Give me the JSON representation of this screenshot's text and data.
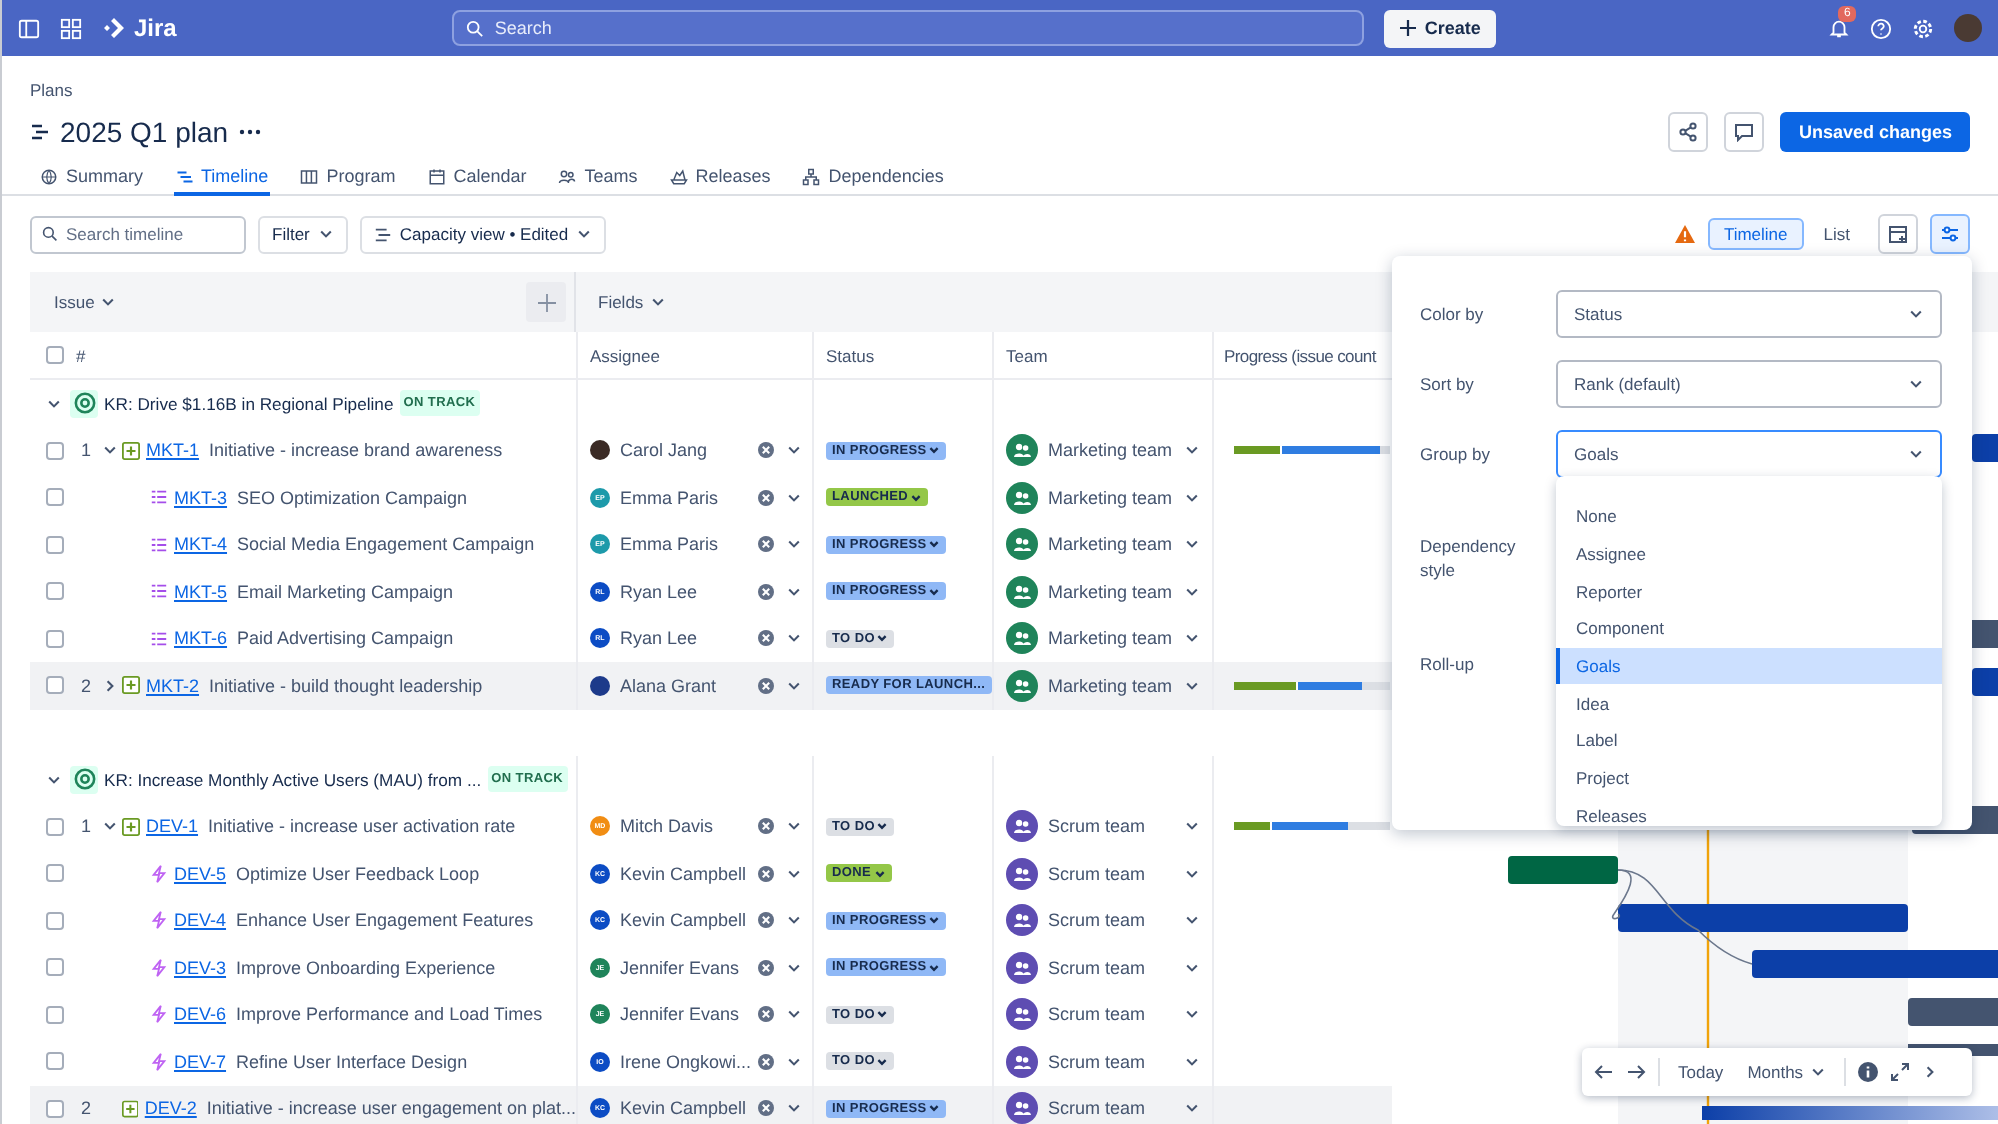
{
  "topbar": {
    "product": "Jira",
    "search": {
      "placeholder": "Search"
    },
    "create": "Create",
    "notifications_badge": "6"
  },
  "breadcrumb": "Plans",
  "title": "2025 Q1 plan",
  "primary_action": "Unsaved changes",
  "tabs": [
    {
      "label": "Summary",
      "selected": false
    },
    {
      "label": "Timeline",
      "selected": true
    },
    {
      "label": "Program",
      "selected": false
    },
    {
      "label": "Calendar",
      "selected": false
    },
    {
      "label": "Teams",
      "selected": false
    },
    {
      "label": "Releases",
      "selected": false
    },
    {
      "label": "Dependencies",
      "selected": false
    }
  ],
  "toolbar": {
    "search": {
      "placeholder": "Search timeline"
    },
    "filter": "Filter",
    "view": "Capacity view • Edited",
    "view_toggle": [
      {
        "label": "Timeline",
        "selected": true
      },
      {
        "label": "List",
        "selected": false
      }
    ],
    "settings_selected": true
  },
  "table": {
    "select_all_checked": false,
    "issue_header": "Issue",
    "fields_header": "Fields",
    "columns": [
      "#",
      "Assignee",
      "Status",
      "Team",
      "Progress (issue count"
    ],
    "groups": [
      {
        "title": "KR: Drive $1.16B in Regional Pipeline",
        "status": "ON TRACK",
        "expanded": true,
        "rows": [
          {
            "num": "1",
            "kind": "initiative",
            "has_children": true,
            "expanded": true,
            "checked": false,
            "selected": false,
            "key": "MKT-1",
            "summary": "Initiative - increase brand awareness",
            "assignee": {
              "name": "Carol Jang",
              "kind": "photo",
              "color": "#3b2b25"
            },
            "status": {
              "label": "IN PROGRESS",
              "color": "#8fb8f6",
              "dropdown": true
            },
            "team": {
              "name": "Marketing team",
              "color": "#1f845a"
            },
            "progress": [
              {
                "level": 0.31,
                "color": "#6a9a23"
              },
              {
                "level": 0.91,
                "color": "#2f7de1"
              }
            ]
          },
          {
            "kind": "epic",
            "has_children": false,
            "checked": false,
            "selected": false,
            "key": "MKT-3",
            "summary": "SEO Optimization Campaign",
            "assignee": {
              "name": "Emma Paris",
              "kind": "initials",
              "initials": "EP",
              "color": "#1d9aaa"
            },
            "status": {
              "label": "LAUNCHED",
              "color": "#94c748",
              "dropdown": true
            },
            "team": {
              "name": "Marketing team",
              "color": "#1f845a"
            }
          },
          {
            "kind": "epic",
            "has_children": false,
            "checked": false,
            "selected": false,
            "key": "MKT-4",
            "summary": "Social Media Engagement Campaign",
            "assignee": {
              "name": "Emma Paris",
              "kind": "initials",
              "initials": "EP",
              "color": "#1d9aaa"
            },
            "status": {
              "label": "IN PROGRESS",
              "color": "#8fb8f6",
              "dropdown": true
            },
            "team": {
              "name": "Marketing team",
              "color": "#1f845a"
            }
          },
          {
            "kind": "epic",
            "has_children": false,
            "checked": false,
            "selected": false,
            "key": "MKT-5",
            "summary": "Email Marketing Campaign",
            "assignee": {
              "name": "Ryan Lee",
              "kind": "initials",
              "initials": "RL",
              "color": "#0c4cc4"
            },
            "status": {
              "label": "IN PROGRESS",
              "color": "#8fb8f6",
              "dropdown": true
            },
            "team": {
              "name": "Marketing team",
              "color": "#1f845a"
            }
          },
          {
            "kind": "epic",
            "has_children": false,
            "checked": false,
            "selected": false,
            "key": "MKT-6",
            "summary": "Paid Advertising Campaign",
            "assignee": {
              "name": "Ryan Lee",
              "kind": "initials",
              "initials": "RL",
              "color": "#0c4cc4"
            },
            "status": {
              "label": "TO DO",
              "color": "#dcdfe4",
              "dropdown": true
            },
            "team": {
              "name": "Marketing team",
              "color": "#1f845a"
            }
          },
          {
            "num": "2",
            "kind": "initiative",
            "has_children": true,
            "expanded": false,
            "checked": false,
            "selected": true,
            "key": "MKT-2",
            "summary": "Initiative - build thought leadership",
            "assignee": {
              "name": "Alana Grant",
              "kind": "photo",
              "color": "#1d3a8a"
            },
            "status": {
              "label": "READY FOR LAUNCH...",
              "color": "#8fb8f6",
              "dropdown": false
            },
            "team": {
              "name": "Marketing team",
              "color": "#1f845a"
            },
            "progress": [
              {
                "level": 0.41,
                "color": "#6a9a23"
              },
              {
                "level": 0.7,
                "color": "#2f7de1"
              }
            ]
          }
        ]
      },
      {
        "title": "KR: Increase Monthly Active Users (MAU) from ...",
        "status": "ON TRACK",
        "expanded": true,
        "rows": [
          {
            "num": "1",
            "kind": "initiative",
            "has_children": true,
            "expanded": true,
            "checked": false,
            "selected": false,
            "key": "DEV-1",
            "summary": "Initiative - increase user activation rate",
            "assignee": {
              "name": "Mitch Davis",
              "kind": "initials",
              "initials": "MD",
              "color": "#f18d13"
            },
            "status": {
              "label": "TO DO",
              "color": "#dcdfe4",
              "dropdown": true
            },
            "team": {
              "name": "Scrum team",
              "color": "#5e4db2"
            },
            "progress": [
              {
                "level": 0.24,
                "color": "#6a9a23"
              },
              {
                "level": 0.64,
                "color": "#2f7de1"
              }
            ]
          },
          {
            "kind": "story",
            "has_children": false,
            "checked": false,
            "selected": false,
            "key": "DEV-5",
            "summary": "Optimize User Feedback Loop",
            "assignee": {
              "name": "Kevin Campbell",
              "kind": "initials",
              "initials": "KC",
              "color": "#0c4cc4"
            },
            "status": {
              "label": "DONE",
              "color": "#94c748",
              "dropdown": true
            },
            "team": {
              "name": "Scrum team",
              "color": "#5e4db2"
            }
          },
          {
            "kind": "story",
            "has_children": false,
            "checked": false,
            "selected": false,
            "key": "DEV-4",
            "summary": "Enhance User Engagement Features",
            "assignee": {
              "name": "Kevin Campbell",
              "kind": "initials",
              "initials": "KC",
              "color": "#0c4cc4"
            },
            "status": {
              "label": "IN PROGRESS",
              "color": "#8fb8f6",
              "dropdown": true
            },
            "team": {
              "name": "Scrum team",
              "color": "#5e4db2"
            }
          },
          {
            "kind": "story",
            "has_children": false,
            "checked": false,
            "selected": false,
            "key": "DEV-3",
            "summary": "Improve Onboarding Experience",
            "assignee": {
              "name": "Jennifer Evans",
              "kind": "initials",
              "initials": "JE",
              "color": "#1f845a"
            },
            "status": {
              "label": "IN PROGRESS",
              "color": "#8fb8f6",
              "dropdown": true
            },
            "team": {
              "name": "Scrum team",
              "color": "#5e4db2"
            }
          },
          {
            "kind": "story",
            "has_children": false,
            "checked": false,
            "selected": false,
            "key": "DEV-6",
            "summary": "Improve Performance and Load Times",
            "assignee": {
              "name": "Jennifer Evans",
              "kind": "initials",
              "initials": "JE",
              "color": "#1f845a"
            },
            "status": {
              "label": "TO DO",
              "color": "#dcdfe4",
              "dropdown": true
            },
            "team": {
              "name": "Scrum team",
              "color": "#5e4db2"
            }
          },
          {
            "kind": "story",
            "has_children": false,
            "checked": false,
            "selected": false,
            "key": "DEV-7",
            "summary": "Refine User Interface Design",
            "assignee": {
              "name": "Irene Ongkowi...",
              "kind": "initials",
              "initials": "IO",
              "color": "#0c4cc4"
            },
            "status": {
              "label": "TO DO",
              "color": "#dcdfe4",
              "dropdown": true
            },
            "team": {
              "name": "Scrum team",
              "color": "#5e4db2"
            }
          },
          {
            "num": "2",
            "kind": "initiative",
            "has_children": false,
            "checked": false,
            "selected": true,
            "key": "DEV-2",
            "summary": "Initiative - increase user engagement on plat...",
            "assignee": {
              "name": "Kevin Campbell",
              "kind": "initials",
              "initials": "KC",
              "color": "#0c4cc4"
            },
            "status": {
              "label": "IN PROGRESS",
              "color": "#8fb8f6",
              "dropdown": true
            },
            "team": {
              "name": "Scrum team",
              "color": "#5e4db2"
            }
          }
        ]
      }
    ]
  },
  "settings_panel": {
    "fields": [
      {
        "label": "Color by",
        "value": "Status",
        "focused": false
      },
      {
        "label": "Sort by",
        "value": "Rank (default)",
        "focused": false
      },
      {
        "label": "Group by",
        "value": "Goals",
        "focused": true
      },
      {
        "label": "Dependency style"
      },
      {
        "label": "Roll-up"
      }
    ],
    "options": [
      {
        "label": "None",
        "selected": false
      },
      {
        "label": "Assignee",
        "selected": false
      },
      {
        "label": "Reporter",
        "selected": false
      },
      {
        "label": "Component",
        "selected": false
      },
      {
        "label": "Goals",
        "selected": true
      },
      {
        "label": "Idea",
        "selected": false
      },
      {
        "label": "Label",
        "selected": false
      },
      {
        "label": "Project",
        "selected": false
      },
      {
        "label": "Releases",
        "selected": false
      }
    ]
  },
  "timeline_nav": {
    "today": "Today",
    "scale": "Months"
  }
}
